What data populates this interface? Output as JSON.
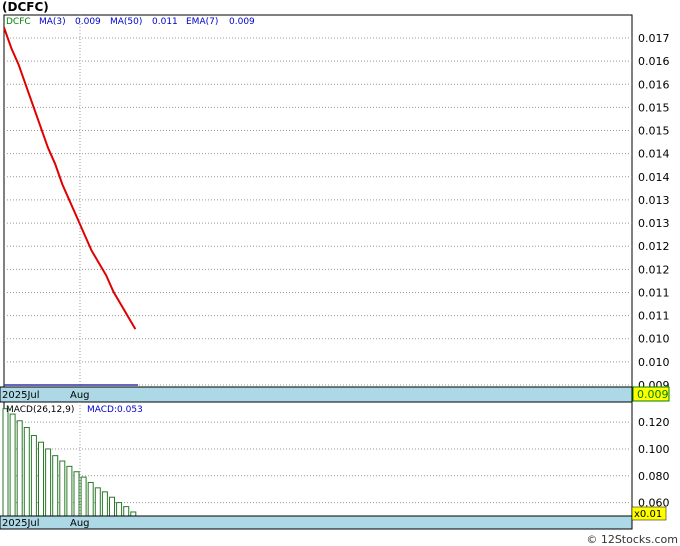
{
  "title": "(DCFC)",
  "legend": {
    "ticker": "DCFC",
    "ma3_label": "MA(3)",
    "ma3_value": "0.009",
    "ma50_label": "MA(50)",
    "ma50_value": "0.011",
    "ema7_label": "EMA(7)",
    "ema7_value": "0.009"
  },
  "price_axis_labels": [
    "0.017",
    "0.016",
    "0.016",
    "0.015",
    "0.015",
    "0.014",
    "0.014",
    "0.013",
    "0.013",
    "0.012",
    "0.012",
    "0.011",
    "0.011",
    "0.010",
    "0.010",
    "0.009"
  ],
  "x_labels": [
    "2025Jul",
    "Aug"
  ],
  "current_price_tag": "0.009",
  "macd_legend": {
    "label": "MACD(26,12,9)",
    "value_label": "MACD:0.053"
  },
  "macd_axis_labels": [
    "0.120",
    "0.100",
    "0.080",
    "0.060"
  ],
  "macd_scale_tag": "x0.01",
  "credit": "© 12Stocks.com",
  "colors": {
    "price_line": "#e00000",
    "macd_bar": "#2a7a2a",
    "axis_band": "#add8e6",
    "tag_bg": "#ffff00",
    "legend_text": "#0000cc",
    "ticker_text": "#008000"
  },
  "chart_data": [
    {
      "type": "line",
      "series": [
        {
          "x": [
            0,
            1,
            2,
            3,
            4,
            5,
            6,
            7,
            8,
            9,
            10,
            11,
            12,
            13,
            14,
            15,
            16,
            17,
            18
          ],
          "y": [
            0.0174,
            0.0169,
            0.0165,
            0.016,
            0.0155,
            0.015,
            0.0145,
            0.0141,
            0.0136,
            0.0132,
            0.0128,
            0.0124,
            0.012,
            0.0117,
            0.0114,
            0.011,
            0.0107,
            0.0104,
            0.0101
          ]
        }
      ],
      "ylim": [
        0.0087,
        0.0177
      ],
      "xlim": [
        0,
        86
      ]
    },
    {
      "type": "bar",
      "series": [
        {
          "name": "MACD",
          "values": [
            0.13,
            0.126,
            0.121,
            0.116,
            0.11,
            0.105,
            0.1,
            0.095,
            0.091,
            0.087,
            0.083,
            0.079,
            0.075,
            0.071,
            0.068,
            0.064,
            0.06,
            0.057,
            0.053
          ]
        }
      ],
      "ylim": [
        0.05,
        0.135
      ]
    }
  ]
}
